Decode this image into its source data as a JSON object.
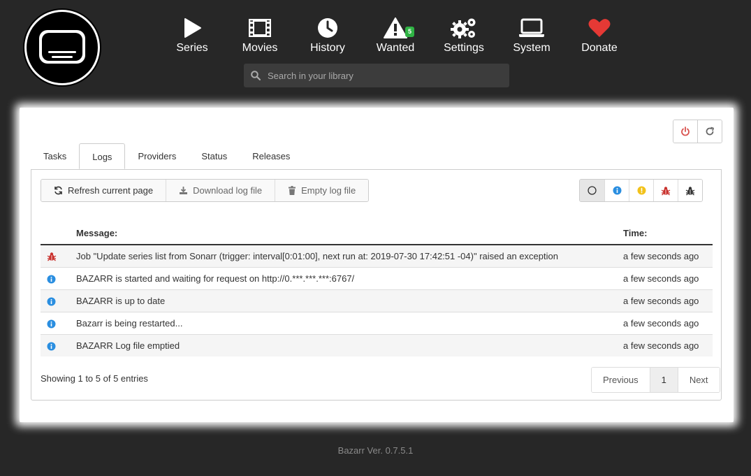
{
  "nav": {
    "items": [
      {
        "label": "Series",
        "icon": "play-icon"
      },
      {
        "label": "Movies",
        "icon": "film-icon"
      },
      {
        "label": "History",
        "icon": "clock-icon"
      },
      {
        "label": "Wanted",
        "icon": "warning-icon",
        "badge": "5"
      },
      {
        "label": "Settings",
        "icon": "gears-icon"
      },
      {
        "label": "System",
        "icon": "laptop-icon"
      },
      {
        "label": "Donate",
        "icon": "heart-icon"
      }
    ]
  },
  "search": {
    "placeholder": "Search in your library"
  },
  "tabs": [
    "Tasks",
    "Logs",
    "Providers",
    "Status",
    "Releases"
  ],
  "active_tab": "Logs",
  "actions": {
    "refresh": "Refresh current page",
    "download": "Download log file",
    "empty": "Empty log file"
  },
  "table": {
    "headers": {
      "message": "Message:",
      "time": "Time:"
    },
    "rows": [
      {
        "level": "error",
        "message": "Job \"Update series list from Sonarr (trigger: interval[0:01:00], next run at: 2019-07-30 17:42:51 -04)\" raised an exception",
        "time": "a few seconds ago"
      },
      {
        "level": "info",
        "message": "BAZARR is started and waiting for request on http://0.***.***.***:6767/",
        "time": "a few seconds ago"
      },
      {
        "level": "info",
        "message": "BAZARR is up to date",
        "time": "a few seconds ago"
      },
      {
        "level": "info",
        "message": "Bazarr is being restarted...",
        "time": "a few seconds ago"
      },
      {
        "level": "info",
        "message": "BAZARR Log file emptied",
        "time": "a few seconds ago"
      }
    ]
  },
  "pagination": {
    "info": "Showing 1 to 5 of 5 entries",
    "previous": "Previous",
    "current": "1",
    "next": "Next"
  },
  "version": "Bazarr Ver. 0.7.5.1",
  "colors": {
    "background": "#272727",
    "badge": "#2fb344",
    "heart": "#e53935",
    "info": "#2a8ee0",
    "warning": "#f2c21b",
    "error": "#c9302c"
  }
}
